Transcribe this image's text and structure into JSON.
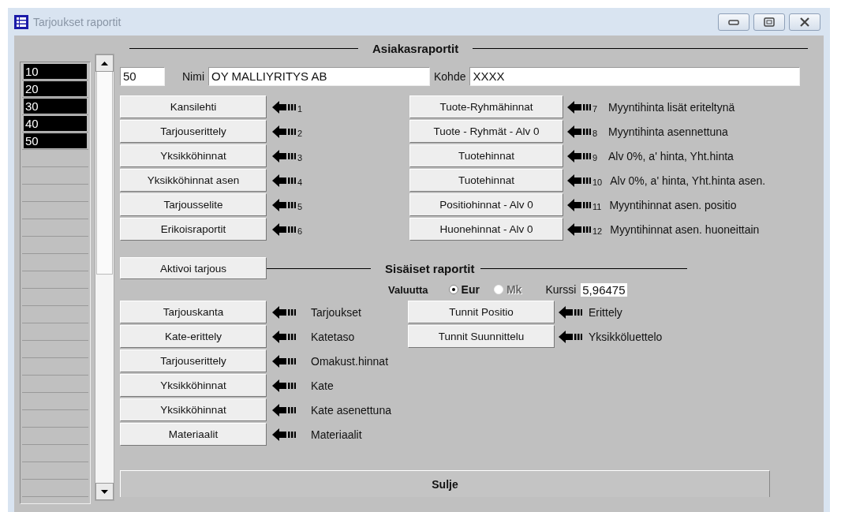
{
  "window": {
    "title": "Tarjoukset raportit"
  },
  "number_list": {
    "items": [
      {
        "label": "10"
      },
      {
        "label": "20"
      },
      {
        "label": "30"
      },
      {
        "label": "40"
      },
      {
        "label": "50"
      }
    ]
  },
  "customer_reports": {
    "heading": "Asiakasraportit",
    "number_field": "50",
    "name_label": "Nimi",
    "name_value": "OY MALLIYRITYS AB",
    "target_label": "Kohde",
    "target_value": "XXXX",
    "left_buttons": [
      {
        "label": "Kansilehti",
        "number": "1"
      },
      {
        "label": "Tarjouserittely",
        "number": "2"
      },
      {
        "label": "Yksikköhinnat",
        "number": "3"
      },
      {
        "label": "Yksikköhinnat asen",
        "number": "4"
      },
      {
        "label": "Tarjousselite",
        "number": "5"
      },
      {
        "label": "Erikoisraportit",
        "number": "6"
      }
    ],
    "right_buttons": [
      {
        "label": "Tuote-Ryhmähinnat",
        "number": "7",
        "description": "Myyntihinta lisät eriteltynä"
      },
      {
        "label": "Tuote - Ryhmät - Alv 0",
        "number": "8",
        "description": "Myyntihinta asennettuna"
      },
      {
        "label": "Tuotehinnat",
        "number": "9",
        "description": "Alv 0%,  a' hinta, Yht.hinta"
      },
      {
        "label": "Tuotehinnat",
        "number": "10",
        "description": "Alv 0%,  a' hinta, Yht.hinta asen."
      },
      {
        "label": "Positiohinnat - Alv 0",
        "number": "11",
        "description": "Myyntihinnat asen. positio"
      },
      {
        "label": "Huonehinnat - Alv 0",
        "number": "12",
        "description": "Myyntihinnat asen. huoneittain"
      }
    ]
  },
  "activate_button": "Aktivoi tarjous",
  "internal_reports": {
    "heading": "Sisäiset raportit",
    "currency": {
      "label": "Valuutta",
      "options": [
        {
          "label": "Eur",
          "selected": true,
          "disabled": false
        },
        {
          "label": "Mk",
          "selected": false,
          "disabled": true
        }
      ],
      "rate_label": "Kurssi",
      "rate_value": "5,96475"
    },
    "left_items": [
      {
        "label": "Tarjouskanta",
        "description": "Tarjoukset"
      },
      {
        "label": "Kate-erittely",
        "description": "Katetaso"
      },
      {
        "label": "Tarjouserittely",
        "description": "Omakust.hinnat"
      },
      {
        "label": "Yksikköhinnat",
        "description": "Kate"
      },
      {
        "label": "Yksikköhinnat",
        "description": "Kate asenettuna"
      },
      {
        "label": "Materiaalit",
        "description": "Materiaalit"
      }
    ],
    "right_items": [
      {
        "label": "Tunnit Positio",
        "description": "Erittely"
      },
      {
        "label": "Tunnit Suunnittelu",
        "description": "Yksikköluettelo"
      }
    ]
  },
  "close_button": "Sulje"
}
